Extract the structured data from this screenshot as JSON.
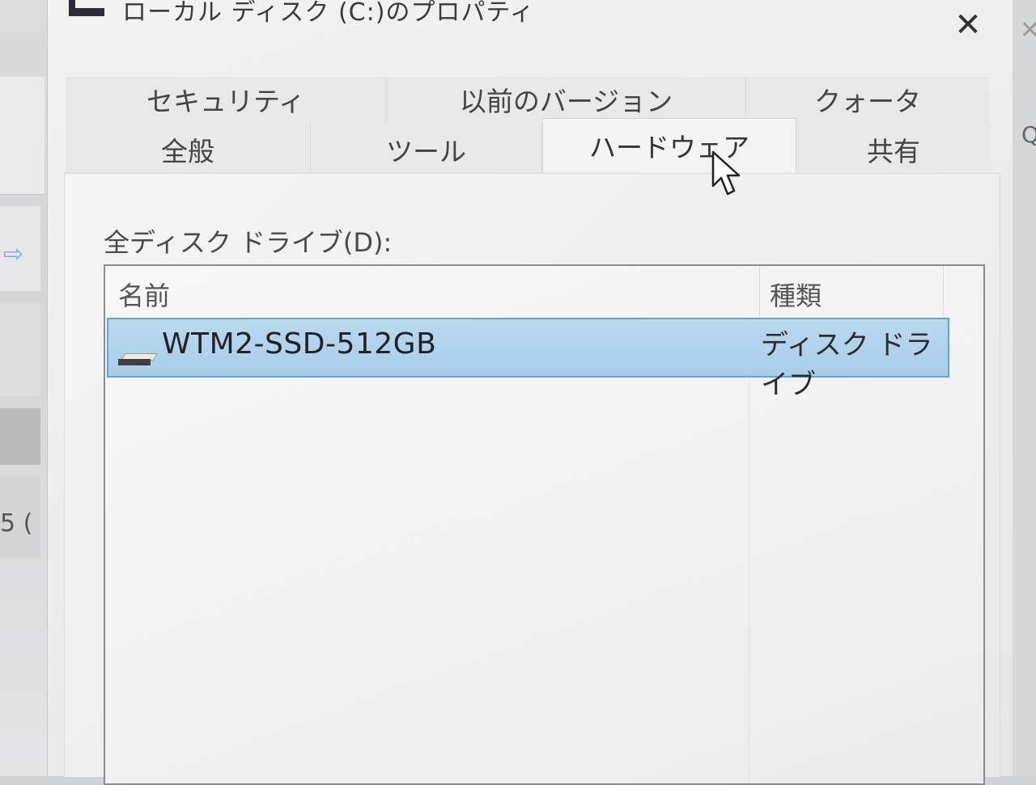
{
  "window": {
    "title": "ローカル ディスク (C:)のプロパティ",
    "close_glyph": "✕"
  },
  "tabs": {
    "row1": [
      "セキュリティ",
      "以前のバージョン",
      "クォータ"
    ],
    "row2": [
      "全般",
      "ツール",
      "ハードウェア",
      "共有"
    ],
    "active": "ハードウェア"
  },
  "hardware": {
    "drives_label": "全ディスク ドライブ(D):",
    "columns": {
      "name": "名前",
      "type": "種類"
    },
    "rows": [
      {
        "name": "WTM2-SSD-512GB",
        "type": "ディスク ドライブ",
        "selected": true,
        "icon": "drive-icon"
      }
    ]
  },
  "background": {
    "left_partial_text": "5 (",
    "right_partial_close": "✕",
    "right_partial_glyph": "Q"
  },
  "colors": {
    "selection": "#b3d4ee",
    "selection_border": "#6e9fcf",
    "dialog_bg": "#f0f0f0"
  }
}
